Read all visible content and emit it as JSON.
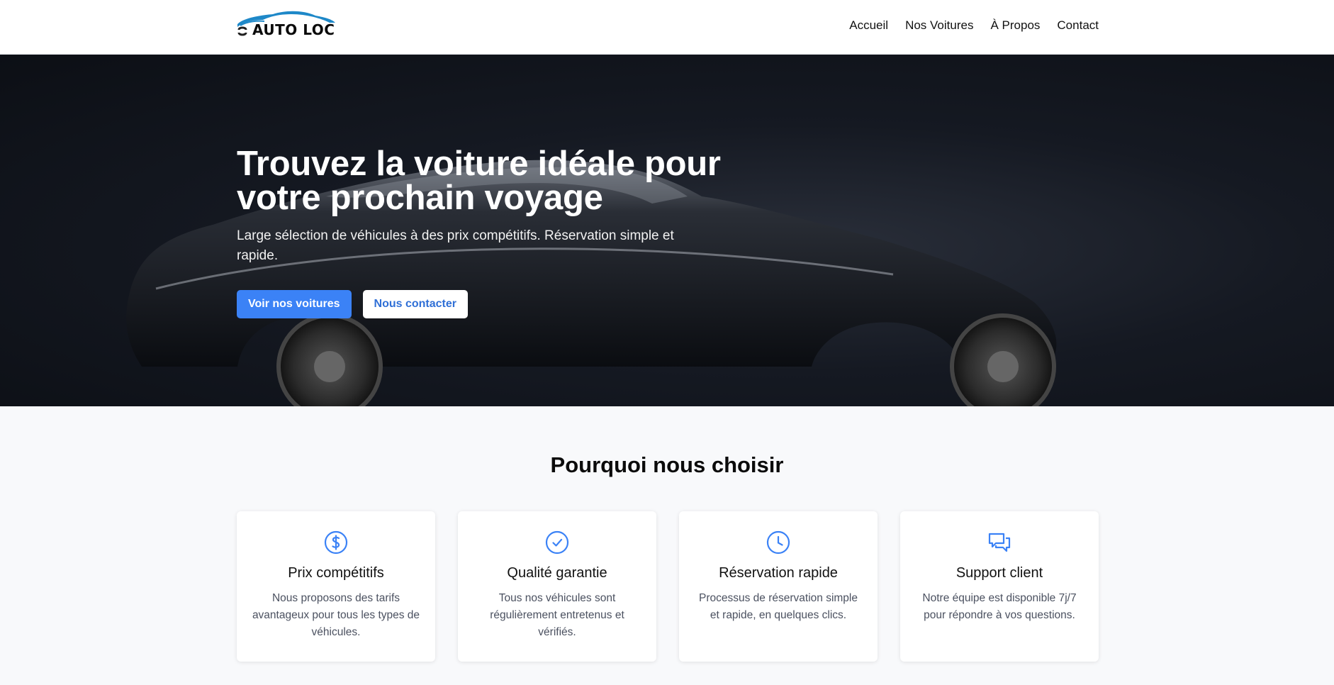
{
  "brand": {
    "name": "AUTO LOC",
    "accent": "#3b82f6",
    "logo_icon": "car-logo-icon"
  },
  "nav": {
    "items": [
      "Accueil",
      "Nos Voitures",
      "À Propos",
      "Contact"
    ]
  },
  "hero": {
    "title": "Trouvez la voiture idéale pour votre prochain voyage",
    "subtitle": "Large sélection de véhicules à des prix compétitifs. Réservation simple et rapide.",
    "primary_button": "Voir nos voitures",
    "secondary_button": "Nous contacter"
  },
  "why": {
    "title": "Pourquoi nous choisir",
    "cards": [
      {
        "icon": "dollar-icon",
        "title": "Prix compétitifs",
        "text": "Nous proposons des tarifs avantageux pour tous les types de véhicules."
      },
      {
        "icon": "check-circle-icon",
        "title": "Qualité garantie",
        "text": "Tous nos véhicules sont régulièrement entretenus et vérifiés."
      },
      {
        "icon": "clock-icon",
        "title": "Réservation rapide",
        "text": "Processus de réservation simple et rapide, en quelques clics."
      },
      {
        "icon": "chat-icon",
        "title": "Support client",
        "text": "Notre équipe est disponible 7j/7 pour répondre à vos questions."
      }
    ]
  }
}
